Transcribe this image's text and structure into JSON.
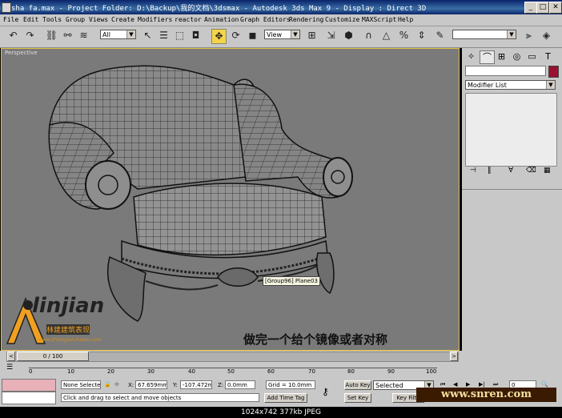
{
  "window": {
    "title": "sha fa.max     - Project Folder: D:\\Backup\\我的文档\\3dsmax     - Autodesk 3ds Max 9     - Display : Direct 3D",
    "minimize": "_",
    "maximize": "□",
    "close": "✕"
  },
  "menu": [
    "File",
    "Edit",
    "Tools",
    "Group",
    "Views",
    "Create",
    "Modifiers",
    "reactor",
    "Animation",
    "Graph Editors",
    "Rendering",
    "Customize",
    "MAXScript",
    "Help"
  ],
  "toolbar": {
    "selection_filter": "All",
    "reference_coord": "View",
    "named_selection": ""
  },
  "viewport": {
    "label": "Perspective",
    "tooltip": "[Group96] Plane03",
    "overlay_text": "做完一个给个镜像或者对称",
    "watermark_logo": "linjian",
    "watermark_sub": "林建建筑表现",
    "watermark_url": "www.zhongjian.tudou.com"
  },
  "command_panel": {
    "object_color": "#9b1030",
    "modifier_list": "Modifier List"
  },
  "timeline": {
    "frame": "0 / 100",
    "ticks": [
      "0",
      "10",
      "20",
      "30",
      "40",
      "50",
      "60",
      "70",
      "80",
      "90",
      "100"
    ]
  },
  "status": {
    "selection": "None Selecte",
    "x_label": "X:",
    "x_value": "67.659mm",
    "y_label": "Y:",
    "y_value": "-107.472mi",
    "z_label": "Z:",
    "z_value": "0.0mm",
    "grid": "Grid = 10.0mm",
    "prompt": "Click and drag to select and move objects",
    "add_time_tag": "Add Time Tag",
    "auto_key": "Auto Key",
    "set_key": "Set Key",
    "key_mode": "Selected",
    "key_filters": "Key Filte",
    "frame_field": "0"
  },
  "footer": {
    "info": "1024x742  377kb  JPEG",
    "site": "www.snren.com"
  }
}
